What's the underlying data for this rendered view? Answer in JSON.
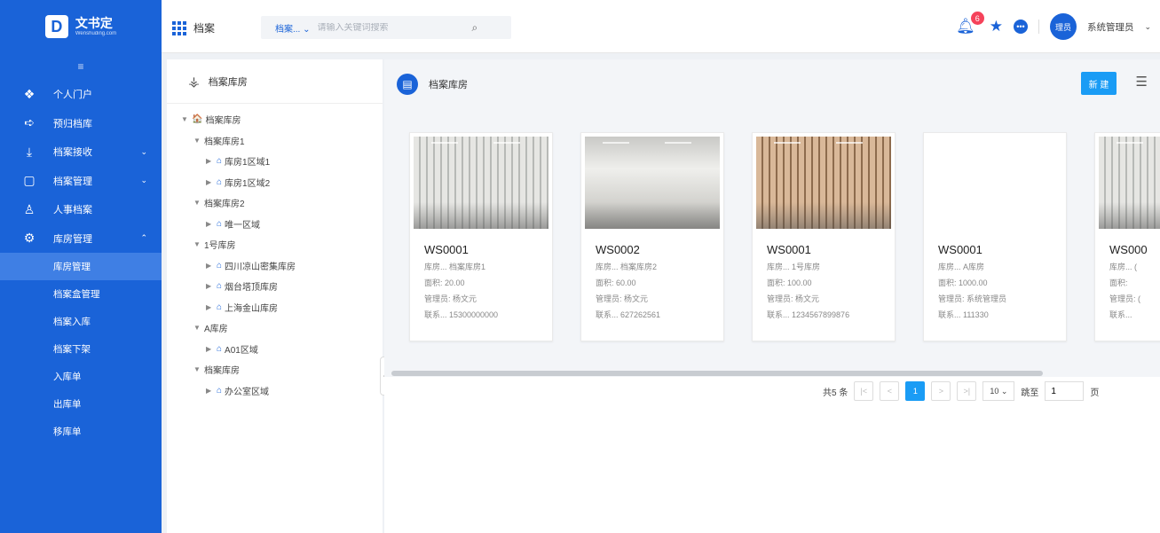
{
  "brand": {
    "mark": "D",
    "name": "文书定",
    "sub": "Wenshuding.com"
  },
  "sidebar": {
    "collapse_icon": "≡",
    "items": [
      {
        "label": "个人门户",
        "icon": "layers-icon",
        "glyph": "❖"
      },
      {
        "label": "预归档库",
        "icon": "arrow-right-icon",
        "glyph": "➪"
      },
      {
        "label": "档案接收",
        "icon": "download-icon",
        "glyph": "⤓",
        "arrow": "⌄"
      },
      {
        "label": "档案管理",
        "icon": "folder-icon",
        "glyph": "▢",
        "arrow": "⌄"
      },
      {
        "label": "人事档案",
        "icon": "user-icon",
        "glyph": "♙"
      },
      {
        "label": "库房管理",
        "icon": "settings-icon",
        "glyph": "⚙",
        "arrow": "⌃"
      }
    ],
    "sub_items": [
      {
        "label": "库房管理",
        "active": true
      },
      {
        "label": "档案盒管理"
      },
      {
        "label": "档案入库"
      },
      {
        "label": "档案下架"
      },
      {
        "label": "入库单"
      },
      {
        "label": "出库单"
      },
      {
        "label": "移库单"
      }
    ]
  },
  "topbar": {
    "title": "档案",
    "search_select": "档案...",
    "search_placeholder": "请输入关键词搜索",
    "notification_count": "6",
    "avatar_text": "理员",
    "username": "系统管理员"
  },
  "tree": {
    "title": "档案库房",
    "nodes": [
      {
        "label": "档案库房",
        "level": 0,
        "toggle": "▼",
        "icon": "🏠"
      },
      {
        "label": "档案库房1",
        "level": 1,
        "toggle": "▼"
      },
      {
        "label": "库房1区域1",
        "level": 2,
        "toggle": "▶",
        "icon": "⌂"
      },
      {
        "label": "库房1区域2",
        "level": 2,
        "toggle": "▶",
        "icon": "⌂"
      },
      {
        "label": "档案库房2",
        "level": 1,
        "toggle": "▼"
      },
      {
        "label": "唯一区域",
        "level": 2,
        "toggle": "▶",
        "icon": "⌂"
      },
      {
        "label": "1号库房",
        "level": 1,
        "toggle": "▼"
      },
      {
        "label": "四川凉山密集库房",
        "level": 2,
        "toggle": "▶",
        "icon": "⌂"
      },
      {
        "label": "烟台塔顶库房",
        "level": 2,
        "toggle": "▶",
        "icon": "⌂"
      },
      {
        "label": "上海金山库房",
        "level": 2,
        "toggle": "▶",
        "icon": "⌂"
      },
      {
        "label": "A库房",
        "level": 1,
        "toggle": "▼"
      },
      {
        "label": "A01区域",
        "level": 2,
        "toggle": "▶",
        "icon": "⌂"
      },
      {
        "label": "档案库房",
        "level": 1,
        "toggle": "▼"
      },
      {
        "label": "办公室区域",
        "level": 2,
        "toggle": "▶",
        "icon": "⌂"
      }
    ]
  },
  "content": {
    "title": "档案库房",
    "new_button": "新 建",
    "cards": [
      {
        "code": "WS0001",
        "room": "库房...  档案库房1",
        "area": "面积:  20.00",
        "manager": "管理员: 杨文元",
        "contact": "联系...  15300000000",
        "style": "s1"
      },
      {
        "code": "WS0002",
        "room": "库房...  档案库房2",
        "area": "面积:  60.00",
        "manager": "管理员: 杨文元",
        "contact": "联系...  627262561",
        "style": "s2"
      },
      {
        "code": "WS0001",
        "room": "库房...  1号库房",
        "area": "面积:  100.00",
        "manager": "管理员: 杨文元",
        "contact": "联系...  1234567899876",
        "style": "s3"
      },
      {
        "code": "WS0001",
        "room": "库房...  A库房",
        "area": "面积:  1000.00",
        "manager": "管理员: 系统管理员",
        "contact": "联系...  111330",
        "style": "s4"
      },
      {
        "code": "WS000",
        "room": "库房...  (",
        "area": "面积:  ",
        "manager": "管理员: (",
        "contact": "联系...  ",
        "style": "s1"
      }
    ]
  },
  "pagination": {
    "total": "共5 条",
    "first": "|<",
    "prev": "<",
    "current": "1",
    "next": ">",
    "last": ">|",
    "size": "10",
    "jump_label": "跳至",
    "jump_value": "1",
    "page_suffix": "页"
  }
}
